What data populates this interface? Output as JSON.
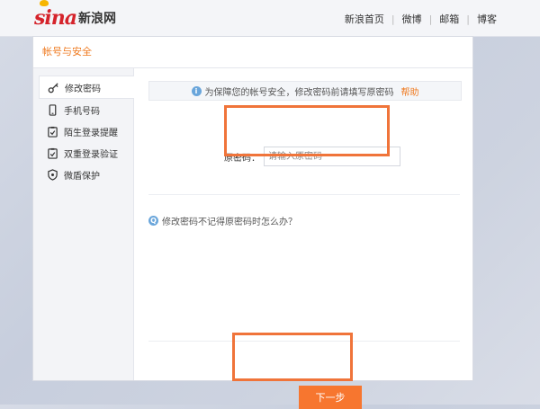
{
  "header": {
    "logo_text": "sina",
    "logo_cn": "新浪网",
    "links": [
      "新浪首页",
      "微博",
      "邮箱",
      "博客"
    ]
  },
  "panel": {
    "title": "帐号与安全"
  },
  "sidebar": {
    "items": [
      {
        "label": "修改密码",
        "icon": "key-icon"
      },
      {
        "label": "手机号码",
        "icon": "phone-icon"
      },
      {
        "label": "陌生登录提醒",
        "icon": "clipboard-check-icon"
      },
      {
        "label": "双重登录验证",
        "icon": "clipboard-check-icon"
      },
      {
        "label": "微盾保护",
        "icon": "shield-icon"
      }
    ]
  },
  "content": {
    "notice": "为保障您的帐号安全，修改密码前请填写原密码",
    "help": "帮助",
    "field_label": "原密码：",
    "field_placeholder": "请输入原密码",
    "faq": "修改密码不记得原密码时怎么办？",
    "next_button": "下一步"
  },
  "colors": {
    "accent": "#f7762f",
    "brand_red": "#d5232b",
    "highlight": "#f0743a"
  }
}
